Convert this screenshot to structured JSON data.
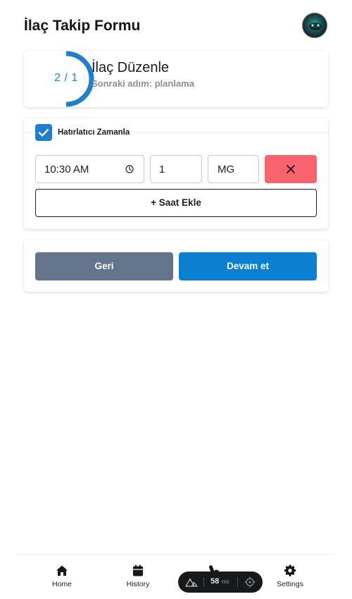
{
  "header": {
    "title": "İlaç Takip Formu"
  },
  "step": {
    "progress_text": "2 / 1",
    "title": "İlaç Düzenle",
    "subtitle": "Sonraki adım: planlama"
  },
  "reminder": {
    "checked": true,
    "label": "Hatırlatıcı Zamanla",
    "time_value": "10:30 AM",
    "quantity_value": "1",
    "unit_value": "MG",
    "add_time_label": "+ Saat Ekle"
  },
  "actions": {
    "back_label": "Geri",
    "next_label": "Devam et"
  },
  "bottom_nav": {
    "items": [
      {
        "label": "Home",
        "icon": "home-icon"
      },
      {
        "label": "History",
        "icon": "calendar-icon"
      },
      {
        "label": "",
        "icon": "pills-icon"
      },
      {
        "label": "Settings",
        "icon": "gear-icon"
      }
    ]
  },
  "devtools": {
    "ms_value": "58",
    "ms_unit": "ms"
  },
  "colors": {
    "accent": "#0c7fd1",
    "back_button": "#64748b",
    "remove_button": "#f8636d",
    "progress_ring": "#1f7fcf"
  }
}
